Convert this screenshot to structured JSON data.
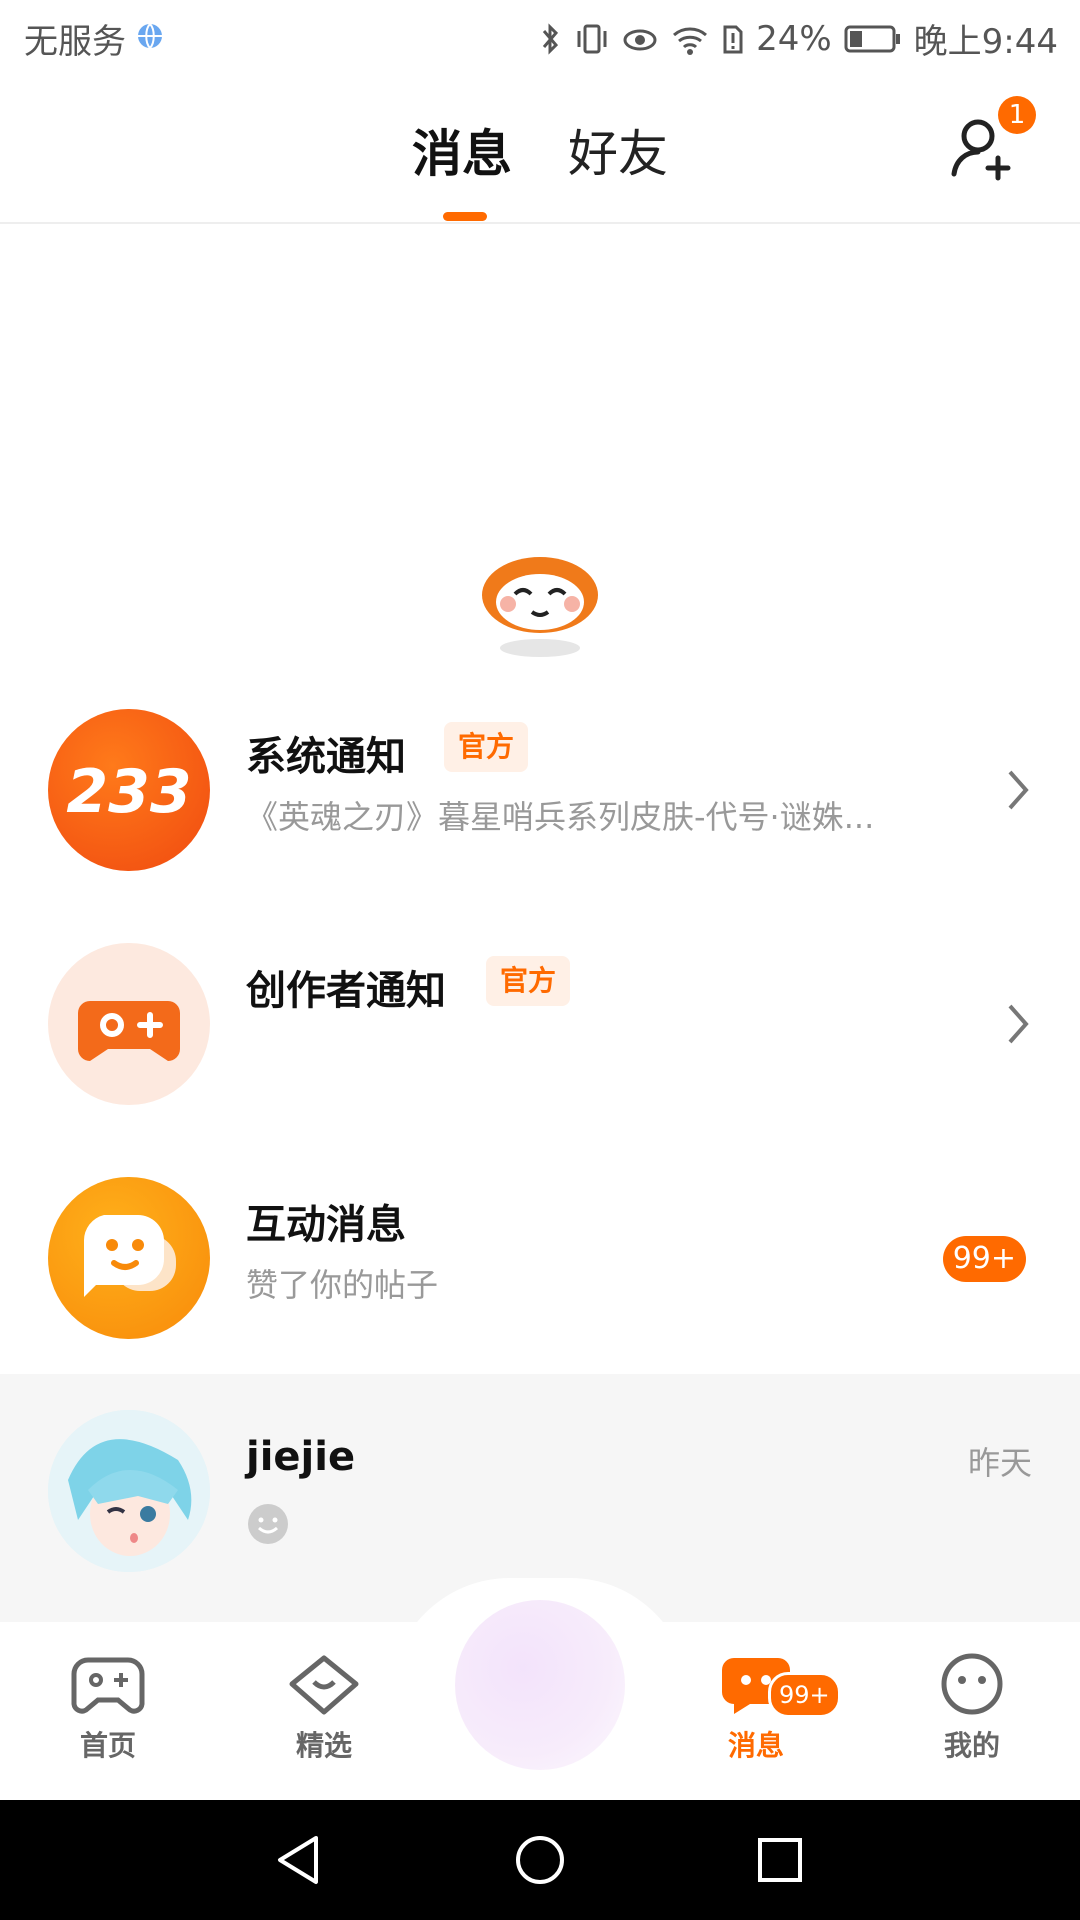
{
  "status_bar": {
    "carrier": "无服务",
    "battery": "24%",
    "time": "晚上9:44"
  },
  "header": {
    "tabs": [
      {
        "label": "消息",
        "active": true
      },
      {
        "label": "好友",
        "active": false
      }
    ],
    "add_friend_badge": "1"
  },
  "notifications": [
    {
      "title": "系统通知",
      "tag": "官方",
      "subtitle": "《英魂之刃》暮星哨兵系列皮肤-代号·谜姝...",
      "avatar_text": "233"
    },
    {
      "title": "创作者通知",
      "tag": "官方",
      "subtitle": ""
    },
    {
      "title": "互动消息",
      "subtitle": "赞了你的帖子",
      "count": "99+"
    }
  ],
  "chat": {
    "name": "jiejie",
    "time": "昨天"
  },
  "bottom_nav": [
    {
      "label": "首页",
      "active": false
    },
    {
      "label": "精选",
      "active": false
    },
    {
      "label": "消息",
      "active": true,
      "badge": "99+"
    },
    {
      "label": "我的",
      "active": false
    }
  ],
  "colors": {
    "accent": "#ff6a00",
    "badge": "#ff6a00",
    "official_bg": "#fff0e6"
  }
}
